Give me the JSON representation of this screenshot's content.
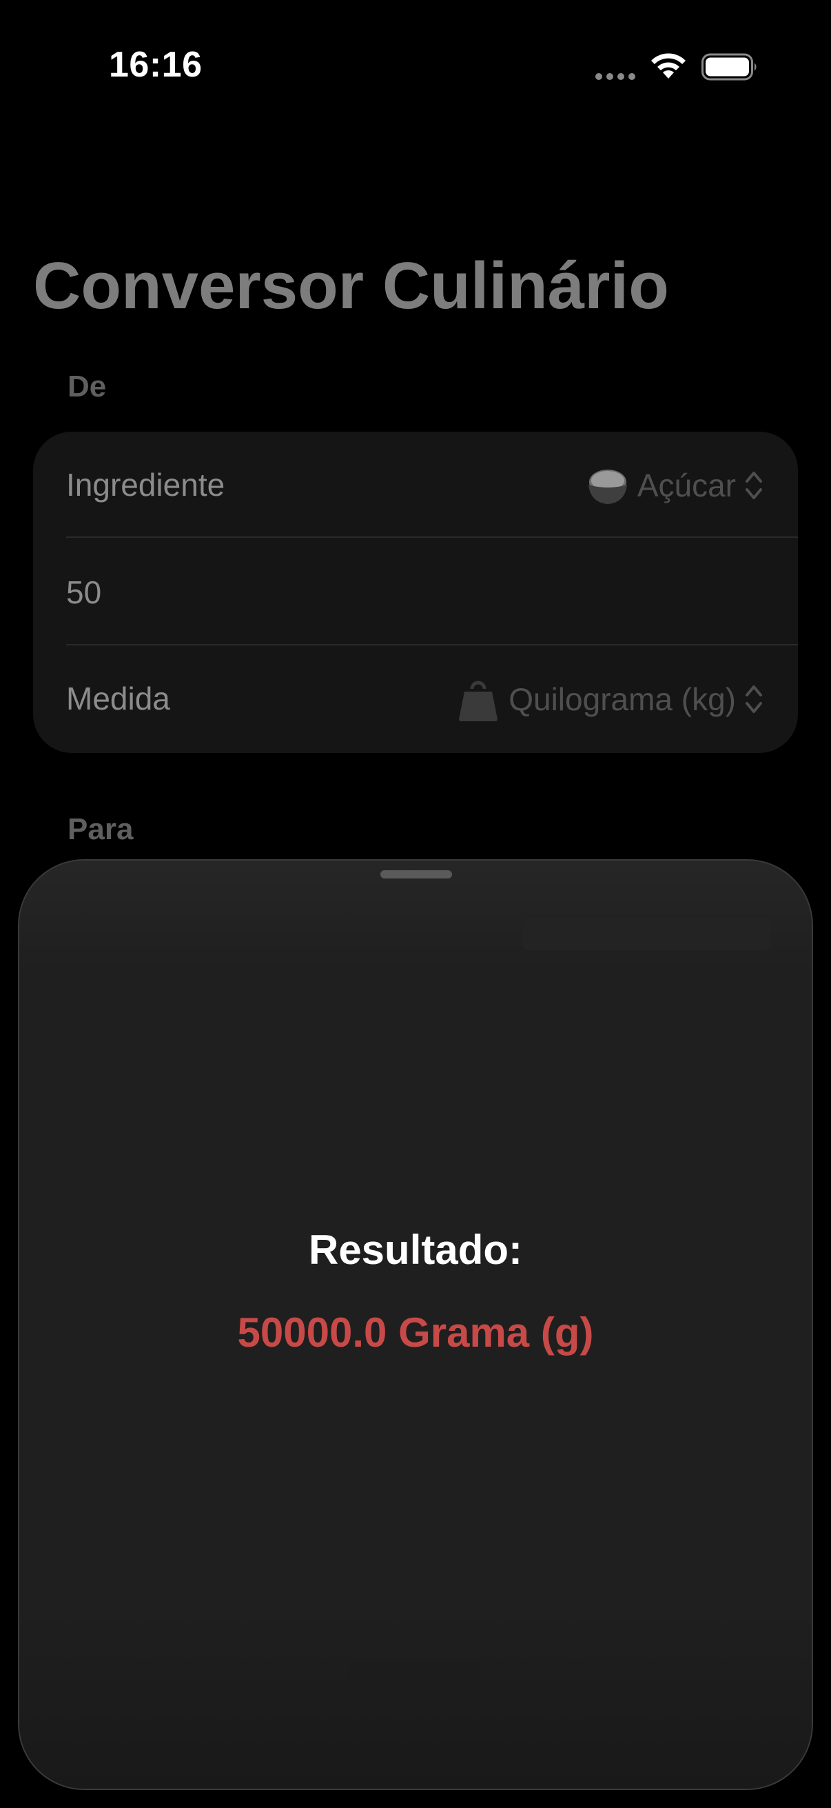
{
  "status_bar": {
    "time": "16:16"
  },
  "page": {
    "title": "Conversor Culinário",
    "section_from": "De",
    "section_to": "Para"
  },
  "form": {
    "ingredient_label": "Ingrediente",
    "ingredient_value": "Açúcar",
    "ingredient_icon": "rice-bowl-icon",
    "amount_value": "50",
    "measure_label": "Medida",
    "measure_value": "Quilograma (kg)",
    "measure_icon": "weight-icon"
  },
  "sheet": {
    "result_title": "Resultado:",
    "result_value": "50000.0 Grama (g)",
    "result_color": "#c84a48"
  }
}
